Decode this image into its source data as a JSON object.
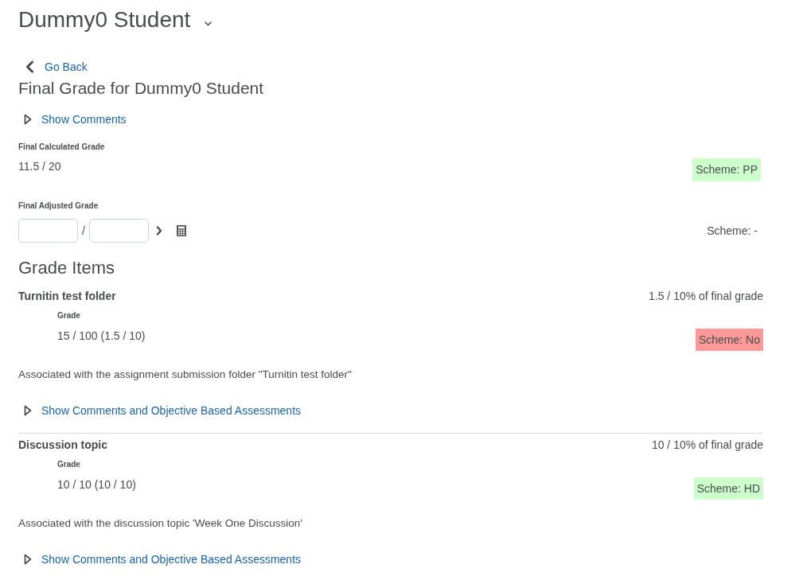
{
  "header": {
    "title": "Dummy0 Student"
  },
  "back_link": {
    "label": "Go Back"
  },
  "final_grade": {
    "heading": "Final Grade for Dummy0 Student",
    "comments_toggle": {
      "label": "Show Comments",
      "expanded": false
    },
    "calculated": {
      "label": "Final Calculated Grade",
      "value": "11.5 / 20",
      "scheme": {
        "text": "Scheme: PP",
        "color": "#ccffcc"
      }
    },
    "adjusted": {
      "label": "Final Adjusted Grade",
      "separator": "/",
      "scheme": {
        "text": "Scheme: -"
      }
    }
  },
  "grade_items": {
    "heading": "Grade Items",
    "items": [
      {
        "name": "Turnitin test folder",
        "weight": "1.5 / 10% of final grade",
        "grade_label": "Grade",
        "grade": "15 / 100 (1.5 / 10)",
        "scheme": {
          "text": "Scheme: No",
          "color": "#ff9999"
        },
        "association": "Associated with the assignment submission folder \"Turnitin test folder\"",
        "comments_toggle": {
          "label": "Show Comments and Objective Based Assessments",
          "expanded": false
        }
      },
      {
        "name": "Discussion topic",
        "weight": "10 / 10% of final grade",
        "grade_label": "Grade",
        "grade": "10 / 10 (10 / 10)",
        "scheme": {
          "text": "Scheme: HD",
          "color": "#ccffcc"
        },
        "association": "Associated with the discussion topic 'Week One Discussion'",
        "comments_toggle": {
          "label": "Show Comments and Objective Based Assessments",
          "expanded": false
        }
      }
    ]
  }
}
